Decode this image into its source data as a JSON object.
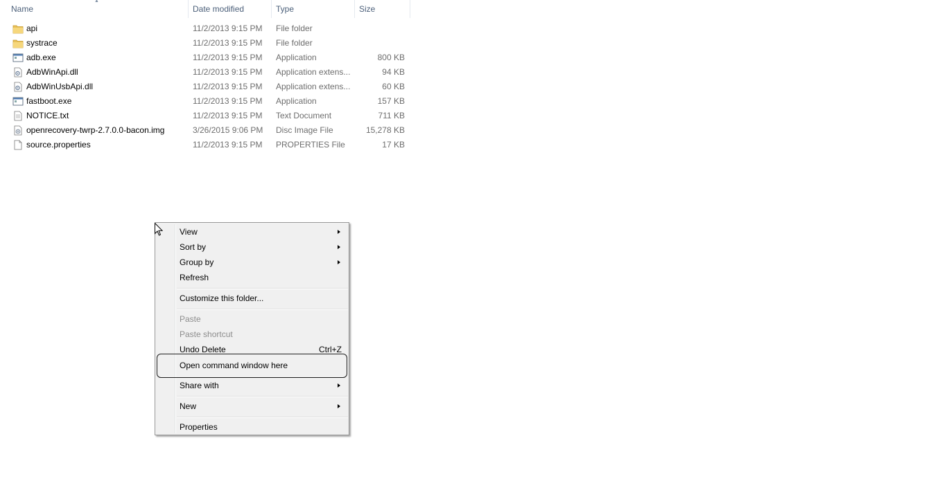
{
  "columns": {
    "name": "Name",
    "date": "Date modified",
    "type": "Type",
    "size": "Size"
  },
  "files": [
    {
      "name": "api",
      "date": "11/2/2013 9:15 PM",
      "type": "File folder",
      "size": "",
      "icon": "folder-icon"
    },
    {
      "name": "systrace",
      "date": "11/2/2013 9:15 PM",
      "type": "File folder",
      "size": "",
      "icon": "folder-icon"
    },
    {
      "name": "adb.exe",
      "date": "11/2/2013 9:15 PM",
      "type": "Application",
      "size": "800 KB",
      "icon": "application-icon"
    },
    {
      "name": "AdbWinApi.dll",
      "date": "11/2/2013 9:15 PM",
      "type": "Application extens...",
      "size": "94 KB",
      "icon": "dll-icon"
    },
    {
      "name": "AdbWinUsbApi.dll",
      "date": "11/2/2013 9:15 PM",
      "type": "Application extens...",
      "size": "60 KB",
      "icon": "dll-icon"
    },
    {
      "name": "fastboot.exe",
      "date": "11/2/2013 9:15 PM",
      "type": "Application",
      "size": "157 KB",
      "icon": "application-icon"
    },
    {
      "name": "NOTICE.txt",
      "date": "11/2/2013 9:15 PM",
      "type": "Text Document",
      "size": "711 KB",
      "icon": "text-file-icon"
    },
    {
      "name": "openrecovery-twrp-2.7.0.0-bacon.img",
      "date": "3/26/2015 9:06 PM",
      "type": "Disc Image File",
      "size": "15,278 KB",
      "icon": "disc-image-icon"
    },
    {
      "name": "source.properties",
      "date": "11/2/2013 9:15 PM",
      "type": "PROPERTIES File",
      "size": "17 KB",
      "icon": "blank-file-icon"
    }
  ],
  "context_menu": {
    "view": "View",
    "sort_by": "Sort by",
    "group_by": "Group by",
    "refresh": "Refresh",
    "customize": "Customize this folder...",
    "paste": "Paste",
    "paste_shortcut": "Paste shortcut",
    "undo_delete": "Undo Delete",
    "undo_shortcut": "Ctrl+Z",
    "open_cmd": "Open command window here",
    "share_with": "Share with",
    "new": "New",
    "properties": "Properties"
  }
}
